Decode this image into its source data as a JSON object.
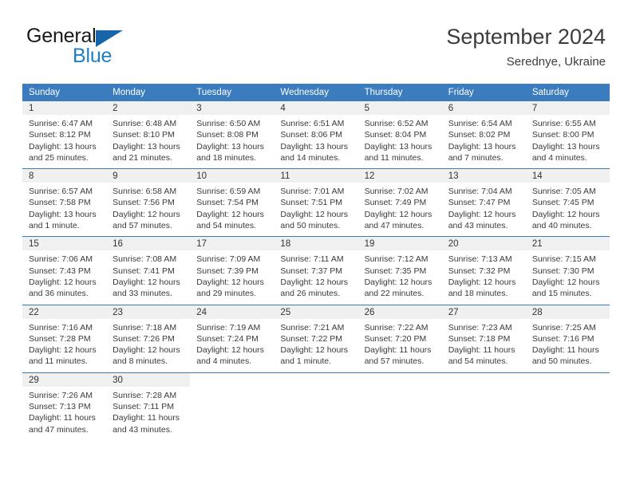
{
  "brand": {
    "name_part1": "General",
    "name_part2": "Blue",
    "colors": {
      "blue": "#1f7fc4",
      "triangle": "#1565a8"
    }
  },
  "header": {
    "title": "September 2024",
    "subtitle": "Serednye, Ukraine"
  },
  "theme": {
    "header_bg": "#3a7cbe",
    "daynum_bg": "#f0f0f0",
    "text": "#333333"
  },
  "weekdays": [
    "Sunday",
    "Monday",
    "Tuesday",
    "Wednesday",
    "Thursday",
    "Friday",
    "Saturday"
  ],
  "weeks": [
    [
      {
        "day": "1",
        "sunrise": "Sunrise: 6:47 AM",
        "sunset": "Sunset: 8:12 PM",
        "daylight": "Daylight: 13 hours and 25 minutes."
      },
      {
        "day": "2",
        "sunrise": "Sunrise: 6:48 AM",
        "sunset": "Sunset: 8:10 PM",
        "daylight": "Daylight: 13 hours and 21 minutes."
      },
      {
        "day": "3",
        "sunrise": "Sunrise: 6:50 AM",
        "sunset": "Sunset: 8:08 PM",
        "daylight": "Daylight: 13 hours and 18 minutes."
      },
      {
        "day": "4",
        "sunrise": "Sunrise: 6:51 AM",
        "sunset": "Sunset: 8:06 PM",
        "daylight": "Daylight: 13 hours and 14 minutes."
      },
      {
        "day": "5",
        "sunrise": "Sunrise: 6:52 AM",
        "sunset": "Sunset: 8:04 PM",
        "daylight": "Daylight: 13 hours and 11 minutes."
      },
      {
        "day": "6",
        "sunrise": "Sunrise: 6:54 AM",
        "sunset": "Sunset: 8:02 PM",
        "daylight": "Daylight: 13 hours and 7 minutes."
      },
      {
        "day": "7",
        "sunrise": "Sunrise: 6:55 AM",
        "sunset": "Sunset: 8:00 PM",
        "daylight": "Daylight: 13 hours and 4 minutes."
      }
    ],
    [
      {
        "day": "8",
        "sunrise": "Sunrise: 6:57 AM",
        "sunset": "Sunset: 7:58 PM",
        "daylight": "Daylight: 13 hours and 1 minute."
      },
      {
        "day": "9",
        "sunrise": "Sunrise: 6:58 AM",
        "sunset": "Sunset: 7:56 PM",
        "daylight": "Daylight: 12 hours and 57 minutes."
      },
      {
        "day": "10",
        "sunrise": "Sunrise: 6:59 AM",
        "sunset": "Sunset: 7:54 PM",
        "daylight": "Daylight: 12 hours and 54 minutes."
      },
      {
        "day": "11",
        "sunrise": "Sunrise: 7:01 AM",
        "sunset": "Sunset: 7:51 PM",
        "daylight": "Daylight: 12 hours and 50 minutes."
      },
      {
        "day": "12",
        "sunrise": "Sunrise: 7:02 AM",
        "sunset": "Sunset: 7:49 PM",
        "daylight": "Daylight: 12 hours and 47 minutes."
      },
      {
        "day": "13",
        "sunrise": "Sunrise: 7:04 AM",
        "sunset": "Sunset: 7:47 PM",
        "daylight": "Daylight: 12 hours and 43 minutes."
      },
      {
        "day": "14",
        "sunrise": "Sunrise: 7:05 AM",
        "sunset": "Sunset: 7:45 PM",
        "daylight": "Daylight: 12 hours and 40 minutes."
      }
    ],
    [
      {
        "day": "15",
        "sunrise": "Sunrise: 7:06 AM",
        "sunset": "Sunset: 7:43 PM",
        "daylight": "Daylight: 12 hours and 36 minutes."
      },
      {
        "day": "16",
        "sunrise": "Sunrise: 7:08 AM",
        "sunset": "Sunset: 7:41 PM",
        "daylight": "Daylight: 12 hours and 33 minutes."
      },
      {
        "day": "17",
        "sunrise": "Sunrise: 7:09 AM",
        "sunset": "Sunset: 7:39 PM",
        "daylight": "Daylight: 12 hours and 29 minutes."
      },
      {
        "day": "18",
        "sunrise": "Sunrise: 7:11 AM",
        "sunset": "Sunset: 7:37 PM",
        "daylight": "Daylight: 12 hours and 26 minutes."
      },
      {
        "day": "19",
        "sunrise": "Sunrise: 7:12 AM",
        "sunset": "Sunset: 7:35 PM",
        "daylight": "Daylight: 12 hours and 22 minutes."
      },
      {
        "day": "20",
        "sunrise": "Sunrise: 7:13 AM",
        "sunset": "Sunset: 7:32 PM",
        "daylight": "Daylight: 12 hours and 18 minutes."
      },
      {
        "day": "21",
        "sunrise": "Sunrise: 7:15 AM",
        "sunset": "Sunset: 7:30 PM",
        "daylight": "Daylight: 12 hours and 15 minutes."
      }
    ],
    [
      {
        "day": "22",
        "sunrise": "Sunrise: 7:16 AM",
        "sunset": "Sunset: 7:28 PM",
        "daylight": "Daylight: 12 hours and 11 minutes."
      },
      {
        "day": "23",
        "sunrise": "Sunrise: 7:18 AM",
        "sunset": "Sunset: 7:26 PM",
        "daylight": "Daylight: 12 hours and 8 minutes."
      },
      {
        "day": "24",
        "sunrise": "Sunrise: 7:19 AM",
        "sunset": "Sunset: 7:24 PM",
        "daylight": "Daylight: 12 hours and 4 minutes."
      },
      {
        "day": "25",
        "sunrise": "Sunrise: 7:21 AM",
        "sunset": "Sunset: 7:22 PM",
        "daylight": "Daylight: 12 hours and 1 minute."
      },
      {
        "day": "26",
        "sunrise": "Sunrise: 7:22 AM",
        "sunset": "Sunset: 7:20 PM",
        "daylight": "Daylight: 11 hours and 57 minutes."
      },
      {
        "day": "27",
        "sunrise": "Sunrise: 7:23 AM",
        "sunset": "Sunset: 7:18 PM",
        "daylight": "Daylight: 11 hours and 54 minutes."
      },
      {
        "day": "28",
        "sunrise": "Sunrise: 7:25 AM",
        "sunset": "Sunset: 7:16 PM",
        "daylight": "Daylight: 11 hours and 50 minutes."
      }
    ],
    [
      {
        "day": "29",
        "sunrise": "Sunrise: 7:26 AM",
        "sunset": "Sunset: 7:13 PM",
        "daylight": "Daylight: 11 hours and 47 minutes."
      },
      {
        "day": "30",
        "sunrise": "Sunrise: 7:28 AM",
        "sunset": "Sunset: 7:11 PM",
        "daylight": "Daylight: 11 hours and 43 minutes."
      },
      {
        "day": "",
        "sunrise": "",
        "sunset": "",
        "daylight": ""
      },
      {
        "day": "",
        "sunrise": "",
        "sunset": "",
        "daylight": ""
      },
      {
        "day": "",
        "sunrise": "",
        "sunset": "",
        "daylight": ""
      },
      {
        "day": "",
        "sunrise": "",
        "sunset": "",
        "daylight": ""
      },
      {
        "day": "",
        "sunrise": "",
        "sunset": "",
        "daylight": ""
      }
    ]
  ]
}
